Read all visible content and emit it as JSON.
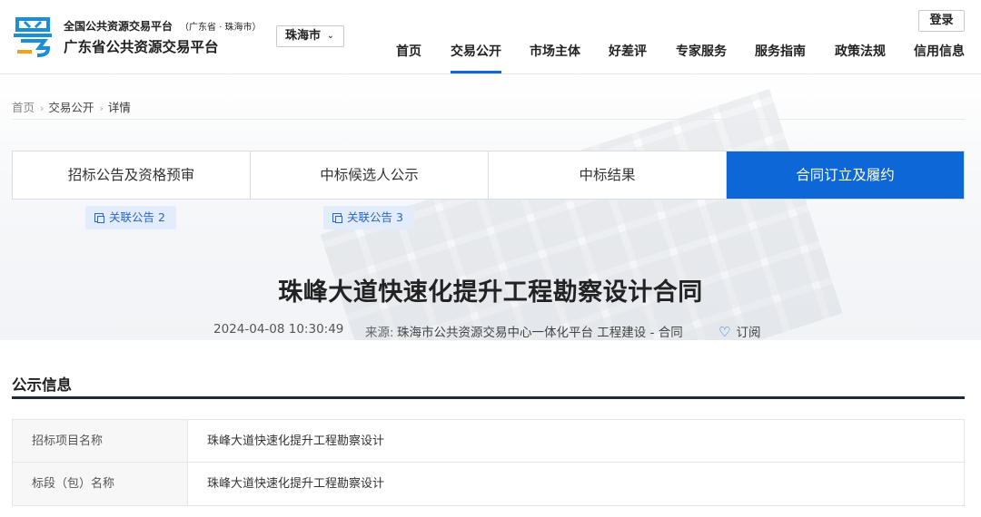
{
  "header": {
    "logo_icon": "yue-character-logo-icon",
    "platform_name": "全国公共资源交易平台",
    "platform_region": "（广东省 · 珠海市）",
    "platform_title": "广东省公共资源交易平台",
    "city_selected": "珠海市",
    "login_label": "登录",
    "brand_color": "#0e67d6"
  },
  "nav": {
    "items": [
      "首页",
      "交易公开",
      "市场主体",
      "好差评",
      "专家服务",
      "服务指南",
      "政策法规",
      "信用信息"
    ],
    "active": "交易公开"
  },
  "breadcrumb": [
    "首页",
    "交易公开",
    "详情"
  ],
  "tabs": {
    "items": [
      "招标公告及资格预审",
      "中标候选人公示",
      "中标结果",
      "合同订立及履约"
    ],
    "active": "合同订立及履约"
  },
  "related": [
    {
      "label": "关联公告 2"
    },
    {
      "label": "关联公告 3"
    }
  ],
  "title": "珠峰大道快速化提升工程勘察设计合同",
  "meta": {
    "datetime": "2024-04-08 10:30:49",
    "source_label": "来源:",
    "source": "珠海市公共资源交易中心一体化平台 工程建设 - 合同",
    "subscribe": "订阅"
  },
  "section": {
    "title": "公示信息",
    "rows": [
      {
        "key": "招标项目名称",
        "value": "珠峰大道快速化提升工程勘察设计"
      },
      {
        "key": "标段（包）名称",
        "value": "珠峰大道快速化提升工程勘察设计"
      }
    ]
  }
}
